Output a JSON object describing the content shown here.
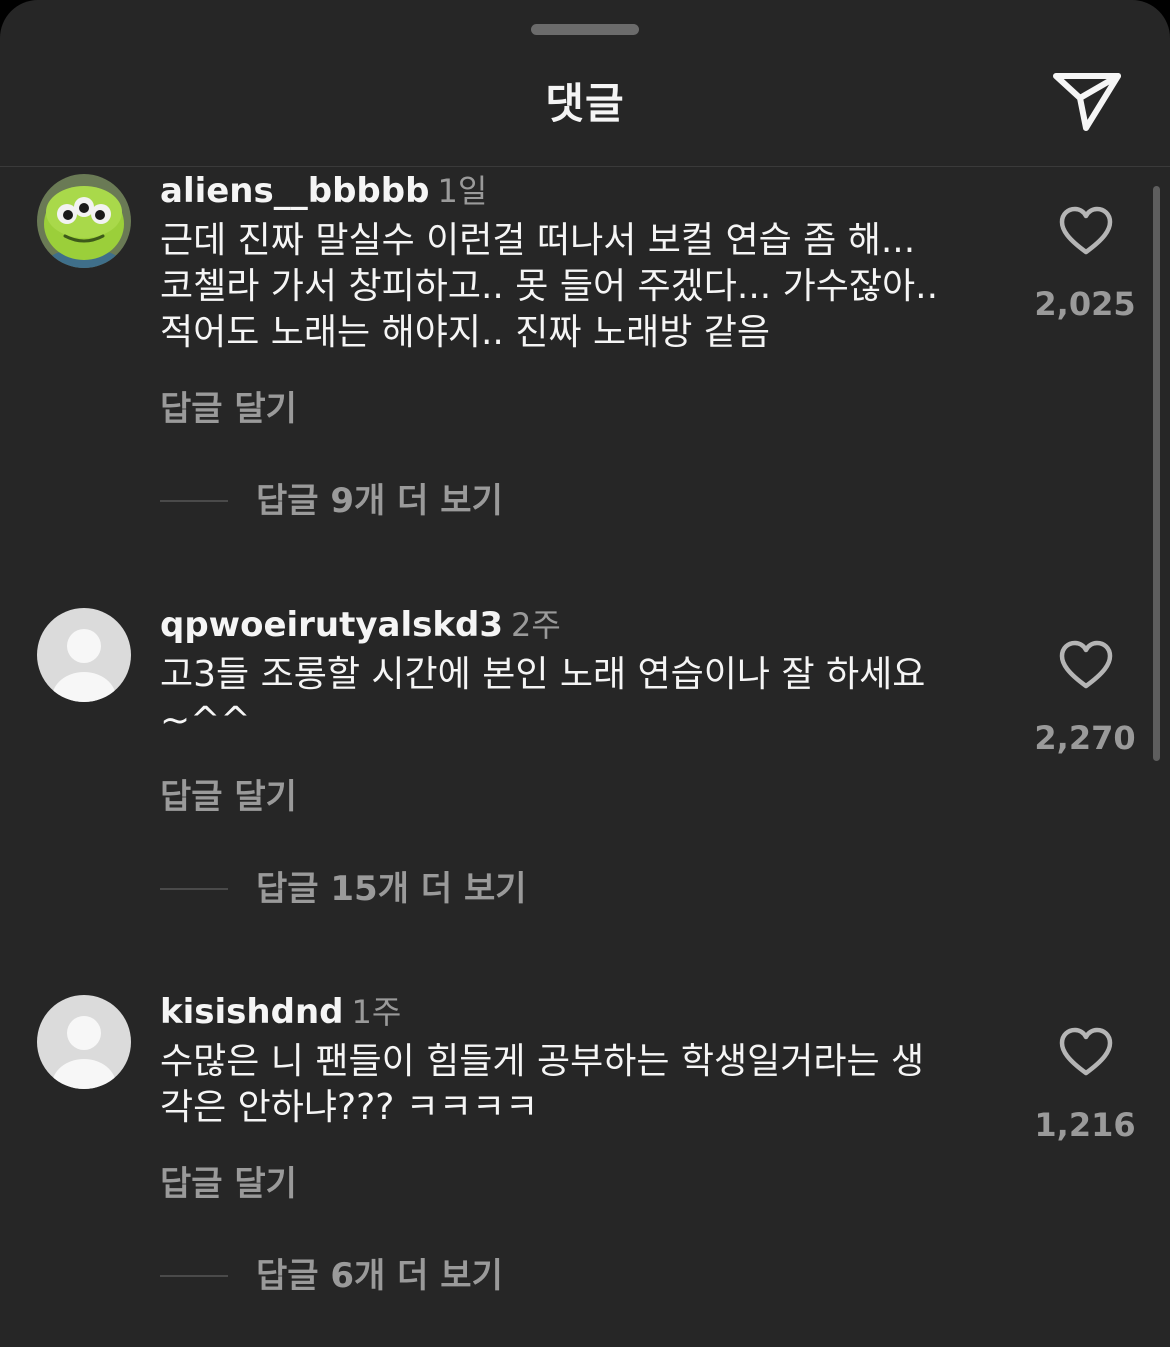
{
  "header": {
    "title": "댓글",
    "share_icon": "paper-plane-icon"
  },
  "colors": {
    "background": "#262626",
    "text_primary": "#f5f5f5",
    "text_secondary": "#9a9a9a"
  },
  "comments": [
    {
      "username": "aliens__bbbbb",
      "time": "1일",
      "text": "근데 진짜 말실수 이런걸 떠나서 보컬 연습 좀 해...\n코첼라 가서 창피하고.. 못 들어 주겠다... 가수잖아..\n적어도 노래는 해야지.. 진짜 노래방 같음",
      "likes": "2,025",
      "reply_label": "답글 달기",
      "view_replies": "답글 9개 더 보기",
      "avatar": "alien-avatar"
    },
    {
      "username": "qpwoeirutyalskd3",
      "time": "2주",
      "text": "고3들 조롱할 시간에 본인 노래 연습이나 잘 하세요\n~^^",
      "likes": "2,270",
      "reply_label": "답글 달기",
      "view_replies": "답글 15개 더 보기",
      "avatar": "default-avatar"
    },
    {
      "username": "kisishdnd",
      "time": "1주",
      "text": "수많은 니 팬들이 힘들게 공부하는 학생일거라는 생\n각은 안하냐??? ㅋㅋㅋㅋ",
      "likes": "1,216",
      "reply_label": "답글 달기",
      "view_replies": "답글 6개 더 보기",
      "avatar": "default-avatar"
    }
  ]
}
